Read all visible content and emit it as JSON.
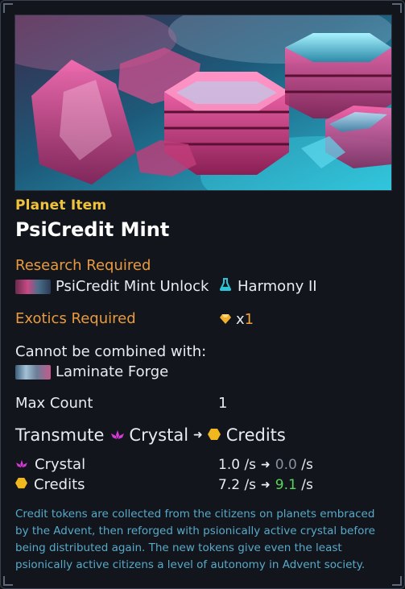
{
  "item": {
    "category": "Planet Item",
    "name": "PsiCredit Mint"
  },
  "research": {
    "heading": "Research Required",
    "tech_name": "PsiCredit Mint Unlock",
    "tech_icon": "tech-thumbnail",
    "field_name": "Harmony II",
    "field_icon": "flask-icon",
    "field_color": "#2ec4d8"
  },
  "exotics": {
    "heading": "Exotics Required",
    "icon": "gem-icon",
    "prefix": "x",
    "amount": "1",
    "gem_color": "#f0b030"
  },
  "combine": {
    "heading": "Cannot be combined with:",
    "item_name": "Laminate Forge"
  },
  "max_count": {
    "label": "Max Count",
    "value": "1"
  },
  "transmute": {
    "label": "Transmute",
    "from": "Crystal",
    "to": "Credits",
    "from_icon": "crystal-icon",
    "to_icon": "credits-icon",
    "crystal_color": "#d63ad6",
    "credits_color": "#f0b81e"
  },
  "rates": [
    {
      "resource": "Crystal",
      "icon": "crystal-icon",
      "base": "1.0",
      "unit": "/s",
      "result": "0.0",
      "result_unit": "/s",
      "result_color": "#8a929e"
    },
    {
      "resource": "Credits",
      "icon": "credits-icon",
      "base": "7.2",
      "unit": "/s",
      "result": "9.1",
      "result_unit": "/s",
      "result_color": "#57d65a"
    }
  ],
  "description": "Credit tokens are collected from the citizens on planets embraced by the Advent, then reforged with psionically active crystal before being distributed again. The new tokens give even the least psionically active citizens a level of autonomy in Advent society."
}
